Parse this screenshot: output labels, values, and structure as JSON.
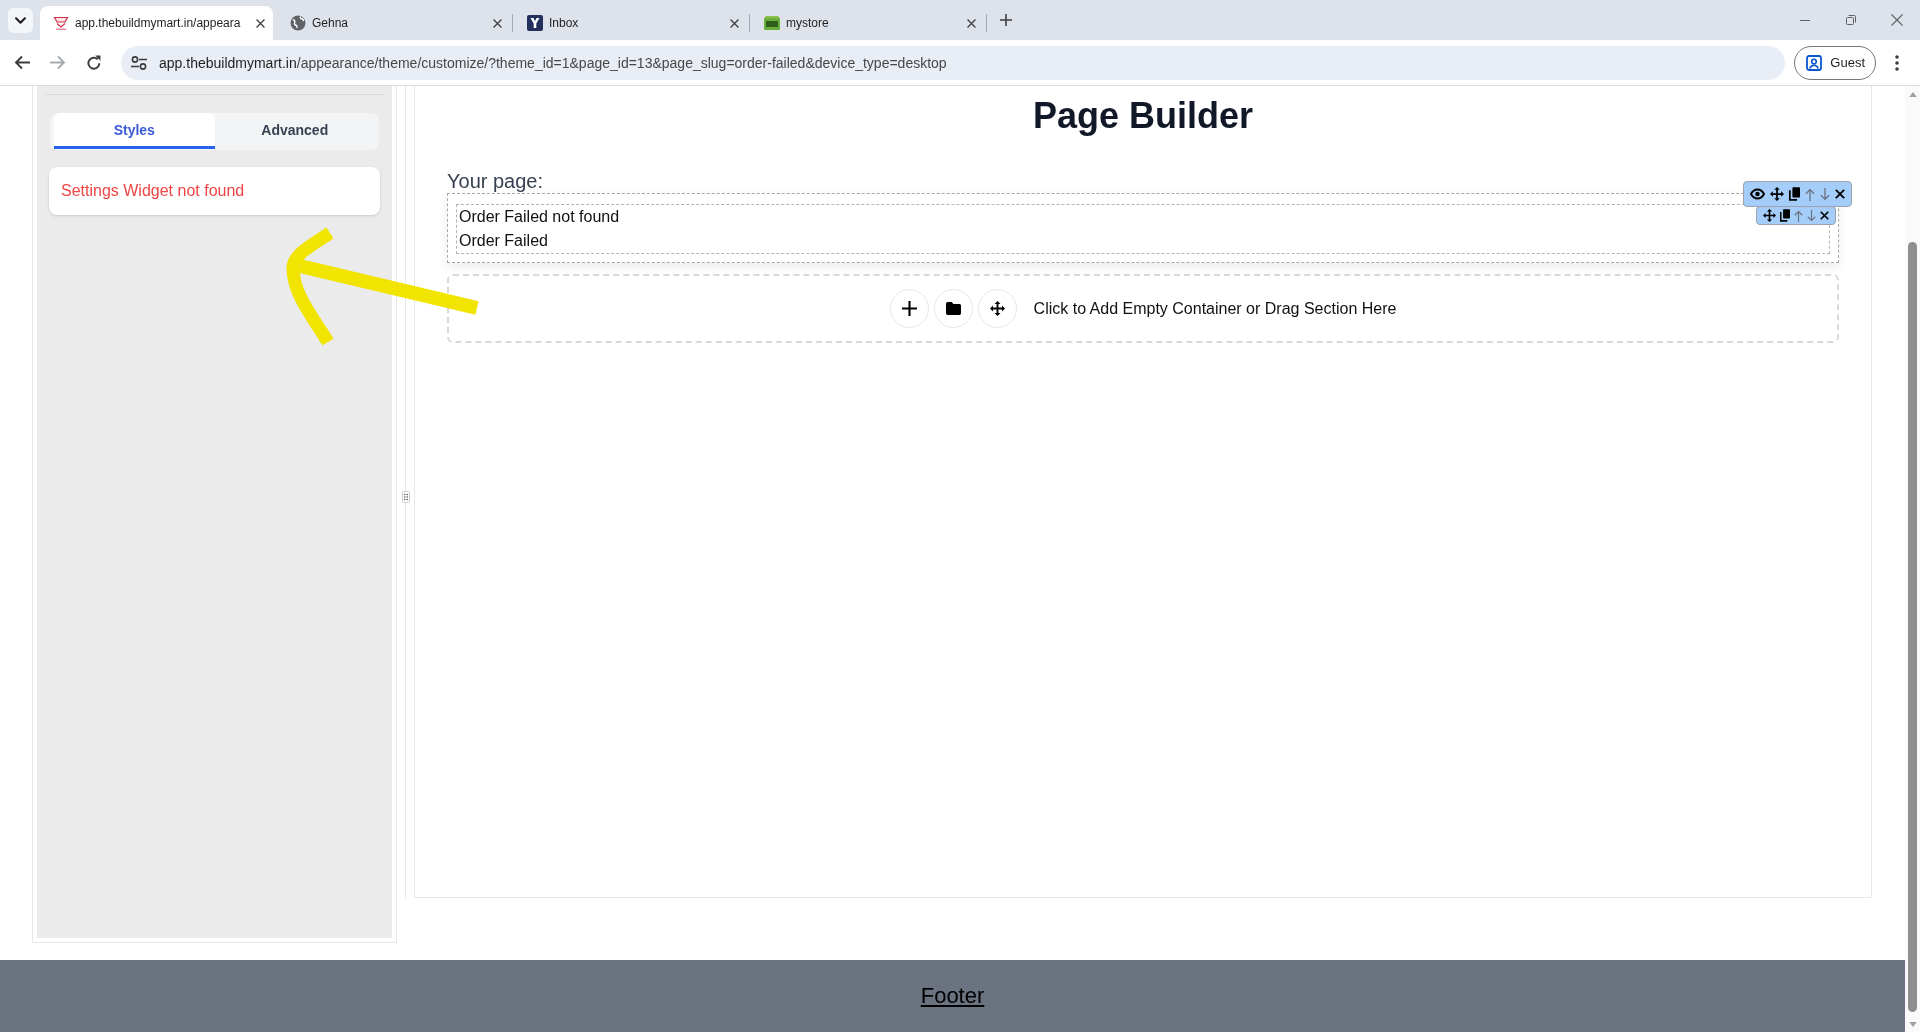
{
  "browser": {
    "tabs": [
      {
        "kind": "logo",
        "title": "app.thebuildmymart.in/appeara",
        "selected": true
      },
      {
        "kind": "globe",
        "title": "Gehna",
        "selected": false
      },
      {
        "kind": "tile",
        "title": "Inbox",
        "selected": false
      },
      {
        "kind": "store",
        "title": "mystore",
        "selected": false
      }
    ],
    "nav": [
      {
        "kind": "back",
        "disabled": false
      },
      {
        "kind": "forward",
        "disabled": true
      },
      {
        "kind": "reload",
        "disabled": false
      }
    ],
    "address": {
      "host": "app.thebuildmymart.in",
      "path": "/appearance/theme/customize/?theme_id=1&page_id=13&page_slug=order-failed&device_type=desktop"
    },
    "profile": {
      "label": "Guest"
    }
  },
  "sidebar": {
    "tabs": [
      {
        "label": "Styles",
        "selected": true
      },
      {
        "label": "Advanced",
        "selected": false
      }
    ],
    "message": "Settings Widget not found"
  },
  "builder": {
    "title": "Page Builder",
    "page_label": "Your page:",
    "section": {
      "toolbar": [
        {
          "kind": "visibility",
          "disabled": false
        },
        {
          "kind": "move",
          "disabled": false
        },
        {
          "kind": "duplicate",
          "disabled": false
        },
        {
          "kind": "up",
          "disabled": true
        },
        {
          "kind": "down",
          "disabled": true
        },
        {
          "kind": "remove",
          "disabled": false
        }
      ],
      "widget": {
        "toolbar": [
          {
            "kind": "move",
            "disabled": false
          },
          {
            "kind": "duplicate",
            "disabled": false
          },
          {
            "kind": "up",
            "disabled": true
          },
          {
            "kind": "down",
            "disabled": true
          },
          {
            "kind": "remove",
            "disabled": false
          }
        ],
        "lines": [
          "Order Failed not found",
          "Order Failed"
        ]
      }
    },
    "dropzone": {
      "actions": [
        {
          "kind": "add"
        },
        {
          "kind": "library"
        },
        {
          "kind": "move"
        }
      ],
      "hint": "Click to Add Empty Container or Drag Section Here"
    }
  },
  "annotations": [
    {
      "kind": "arrow"
    }
  ],
  "footer": {
    "link": "Footer"
  }
}
